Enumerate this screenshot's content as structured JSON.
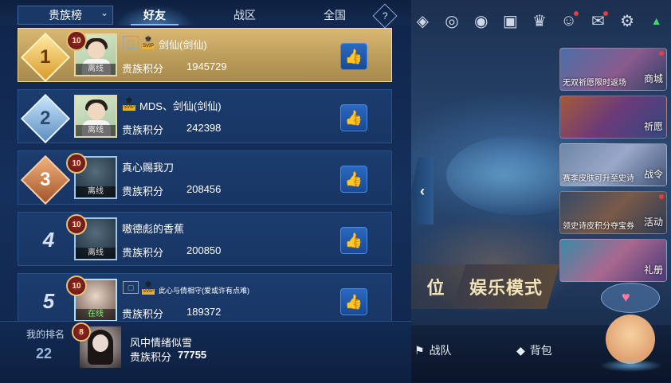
{
  "tabs": {
    "dropdown": "贵族榜",
    "friends": "好友",
    "region": "战区",
    "national": "全国",
    "help": "?"
  },
  "score_label": "贵族积分",
  "entries": [
    {
      "rank": "1",
      "level": "10",
      "name": "剑仙(剑仙)",
      "score": "1945729",
      "status": "离线"
    },
    {
      "rank": "2",
      "level": "",
      "name": "MDS、剑仙(剑仙)",
      "score": "242398",
      "status": "离线"
    },
    {
      "rank": "3",
      "level": "10",
      "name": "真心赐我刀",
      "score": "208456",
      "status": "离线"
    },
    {
      "rank": "4",
      "level": "10",
      "name": "嗷德彪的香蕉",
      "score": "200850",
      "status": "离线"
    },
    {
      "rank": "5",
      "level": "10",
      "name": "此心与倩相守(爱或许有点难)",
      "score": "189372",
      "status": "在线"
    }
  ],
  "vip": {
    "frame": "▢",
    "crown_tag": "SVIP"
  },
  "my_rank": {
    "label": "我的排名",
    "rank": "22",
    "level": "8",
    "name": "风中情绪似雪",
    "score_label": "贵族积分",
    "score": "77755"
  },
  "right_panel": {
    "side_buttons": [
      {
        "label": "商城",
        "sub": "无双祈愿限时返场"
      },
      {
        "label": "祈愿",
        "sub": ""
      },
      {
        "label": "战令",
        "sub": "赛季皮肤可升至史诗"
      },
      {
        "label": "活动",
        "sub": "领史诗皮积分夺宝券"
      },
      {
        "label": "礼册",
        "sub": ""
      }
    ],
    "rank_mode": "位",
    "fun_mode": "娱乐模式",
    "team": "战队",
    "bag": "背包"
  },
  "colors": {
    "accent": "#7cc4ff",
    "gold_row": "#d9b872",
    "row": "#1b3c6e"
  }
}
